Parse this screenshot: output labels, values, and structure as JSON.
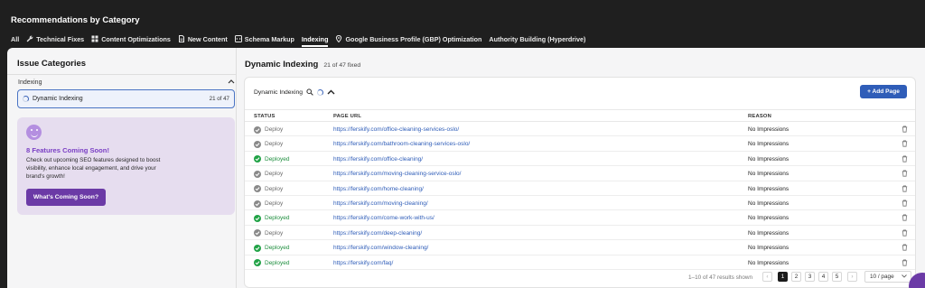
{
  "header": {
    "title": "Recommendations by Category",
    "tabs": [
      {
        "label": "All",
        "icon": ""
      },
      {
        "label": "Technical Fixes",
        "icon": "wrench-icon"
      },
      {
        "label": "Content Optimizations",
        "icon": "grid-icon"
      },
      {
        "label": "New Content",
        "icon": "document-icon"
      },
      {
        "label": "Schema Markup",
        "icon": "code-icon"
      },
      {
        "label": "Indexing",
        "icon": ""
      },
      {
        "label": "Google Business Profile (GBP) Optimization",
        "icon": "location-pin-icon"
      },
      {
        "label": "Authority Building (Hyperdrive)",
        "icon": ""
      }
    ],
    "active_tab": "Indexing"
  },
  "sidebar": {
    "title": "Issue Categories",
    "group_label": "Indexing",
    "item": {
      "label": "Dynamic Indexing",
      "count": "21 of 47"
    },
    "promo": {
      "title": "8 Features Coming Soon!",
      "description": "Check out upcoming SEO features designed to boost visibility, enhance local engagement, and drive your brand's growth!",
      "button": "What's Coming Soon?"
    }
  },
  "main": {
    "title": "Dynamic Indexing",
    "fixed_text": "21 of 47 fixed",
    "panel_label": "Dynamic Indexing",
    "add_button": "+ Add Page",
    "columns": {
      "status": "STATUS",
      "url": "PAGE URL",
      "reason": "REASON"
    },
    "rows": [
      {
        "status": "Deploy",
        "url": "https://ferskify.com/office-cleaning-services-oslo/",
        "reason": "No Impressions"
      },
      {
        "status": "Deploy",
        "url": "https://ferskify.com/bathroom-cleaning-services-oslo/",
        "reason": "No Impressions"
      },
      {
        "status": "Deployed",
        "url": "https://ferskify.com/office-cleaning/",
        "reason": "No Impressions"
      },
      {
        "status": "Deploy",
        "url": "https://ferskify.com/moving-cleaning-service-oslo/",
        "reason": "No Impressions"
      },
      {
        "status": "Deploy",
        "url": "https://ferskify.com/home-cleaning/",
        "reason": "No Impressions"
      },
      {
        "status": "Deploy",
        "url": "https://ferskify.com/moving-cleaning/",
        "reason": "No Impressions"
      },
      {
        "status": "Deployed",
        "url": "https://ferskify.com/come-work-with-us/",
        "reason": "No Impressions"
      },
      {
        "status": "Deploy",
        "url": "https://ferskify.com/deep-cleaning/",
        "reason": "No Impressions"
      },
      {
        "status": "Deployed",
        "url": "https://ferskify.com/window-cleaning/",
        "reason": "No Impressions"
      },
      {
        "status": "Deployed",
        "url": "https://ferskify.com/faq/",
        "reason": "No Impressions"
      }
    ],
    "pagination": {
      "summary": "1–10 of 47 results shown",
      "pages": [
        "1",
        "2",
        "3",
        "4",
        "5"
      ],
      "current": "1",
      "per_page": "10 / page"
    }
  },
  "colors": {
    "accent": "#2f5db8",
    "deployed": "#22a347",
    "deploy": "#8a8a8a",
    "promo": "#6b3aa6"
  }
}
